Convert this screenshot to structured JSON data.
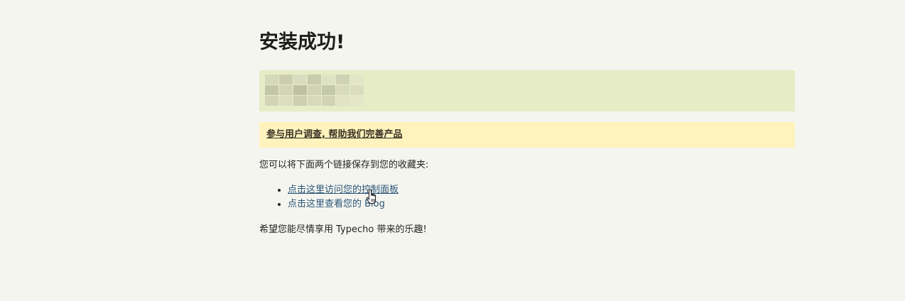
{
  "title": "安装成功!",
  "notice": {
    "link_text": "参与用户调查, 帮助我们完善产品"
  },
  "intro_text": "您可以将下面两个链接保存到您的收藏夹:",
  "links": [
    {
      "label": "点击这里访问您的控制面板"
    },
    {
      "label": "点击这里查看您的 Blog"
    }
  ],
  "outro_text": "希望您能尽情享用 Typecho 带来的乐趣!",
  "colors": {
    "success_bg": "#e6ecc5",
    "notice_bg": "#fff3bd",
    "link": "#2a5576",
    "page_bg": "#f5f5f0"
  },
  "icons": {
    "cursor": "hand-pointer-icon"
  }
}
